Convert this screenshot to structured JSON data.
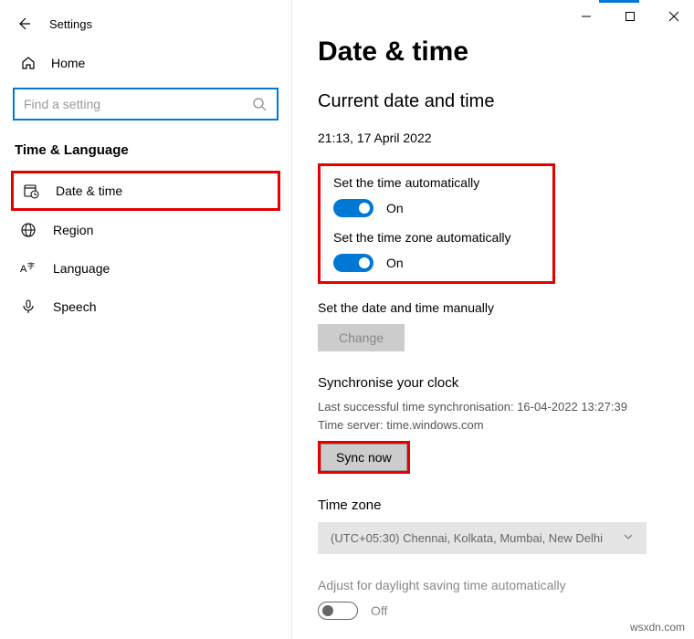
{
  "window": {
    "title": "Settings"
  },
  "sidebar": {
    "home": "Home",
    "search_placeholder": "Find a setting",
    "section": "Time & Language",
    "items": [
      {
        "label": "Date & time",
        "selected": true
      },
      {
        "label": "Region"
      },
      {
        "label": "Language"
      },
      {
        "label": "Speech"
      }
    ]
  },
  "main": {
    "title": "Date & time",
    "subtitle": "Current date and time",
    "current_time": "21:13, 17 April 2022",
    "auto_time_label": "Set the time automatically",
    "auto_time_state": "On",
    "auto_tz_label": "Set the time zone automatically",
    "auto_tz_state": "On",
    "manual_label": "Set the date and time manually",
    "change_btn": "Change",
    "sync_heading": "Synchronise your clock",
    "sync_last": "Last successful time synchronisation: 16-04-2022 13:27:39",
    "sync_server": "Time server: time.windows.com",
    "sync_btn": "Sync now",
    "tz_heading": "Time zone",
    "tz_value": "(UTC+05:30) Chennai, Kolkata, Mumbai, New Delhi",
    "dst_label": "Adjust for daylight saving time automatically",
    "dst_state": "Off"
  },
  "watermark": "wsxdn.com"
}
